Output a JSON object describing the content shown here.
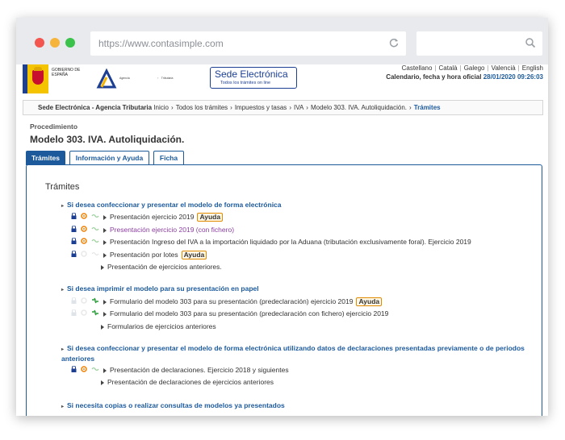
{
  "browser": {
    "url": "https://www.contasimple.com",
    "colors": {
      "close": "#f2564f",
      "minimize": "#f6b53a",
      "maximize": "#3bc24a"
    }
  },
  "header": {
    "gov_text": "GOBIERNO DE ESPAÑA",
    "agency_small": "Agencia",
    "agency_small2": "Tributaria",
    "sede_title": "Sede Electrónica",
    "sede_sub": "Todos los trámites on line",
    "languages": [
      "Castellano",
      "Català",
      "Galego",
      "Valencià",
      "English"
    ],
    "calendar_label": "Calendario, fecha y hora oficial",
    "calendar_value": "28/01/2020 09:26:03"
  },
  "breadcrumb": {
    "first": "Sede Electrónica - Agencia Tributaria",
    "items": [
      "Inicio",
      "Todos los trámites",
      "Impuestos y tasas",
      "IVA",
      "Modelo 303. IVA. Autoliquidación."
    ],
    "last": "Trámites"
  },
  "procedure_label": "Procedimiento",
  "page_title": "Modelo 303. IVA. Autoliquidación.",
  "tabs": [
    "Trámites",
    "Información y Ayuda",
    "Ficha"
  ],
  "panel_heading": "Trámites",
  "help_badge": "Ayuda",
  "sections": [
    {
      "title": "Si desea confeccionar y presentar el modelo de forma electrónica",
      "items": [
        "Presentación ejercicio 2019",
        "Presentación ejercicio 2019 (con fichero)",
        "Presentación Ingreso del IVA a la importación liquidado por la Aduana (tributación exclusivamente foral). Ejercicio 2019",
        "Presentación por lotes",
        "Presentación de ejercicios anteriores."
      ]
    },
    {
      "title": "Si desea imprimir el modelo para su presentación en papel",
      "items": [
        "Formulario del modelo 303 para su presentación (predeclaración) ejercicio 2019",
        "Formulario del modelo 303 para su presentación (predeclaración con fichero) ejercicio 2019",
        "Formularios de ejercicios anteriores"
      ]
    },
    {
      "title": "Si desea confeccionar y presentar el modelo de forma electrónica utilizando datos de declaraciones presentadas previamente o de periodos anteriores",
      "items": [
        "Presentación de declaraciones. Ejercicio 2018 y siguientes",
        "Presentación de declaraciones de ejercicios anteriores"
      ]
    },
    {
      "title": "Si necesita copias o realizar consultas de modelos ya presentados",
      "items": []
    }
  ]
}
